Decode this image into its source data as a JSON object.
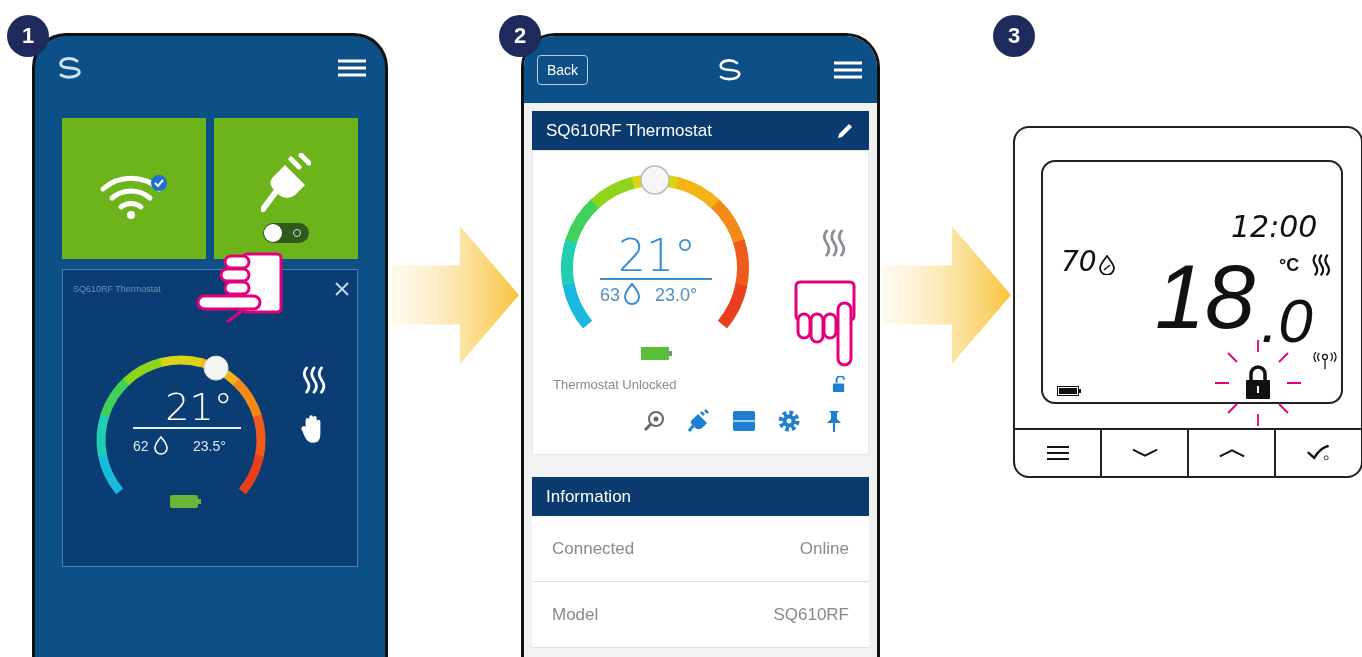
{
  "steps": [
    {
      "number": "1"
    },
    {
      "number": "2"
    },
    {
      "number": "3"
    }
  ],
  "phone_1": {
    "tiles": [
      {
        "kind": "wifi"
      },
      {
        "kind": "plug",
        "on": false
      }
    ],
    "thermostat_card": {
      "title": "SQ610RF Thermostat",
      "setpoint": "21°",
      "humidity": "62",
      "temperature": "23.5°",
      "level": 0.6
    }
  },
  "phone_2": {
    "back_button": "Back",
    "card_title": "SQ610RF Thermostat",
    "setpoint": "21°",
    "humidity": "63",
    "temperature": "23.0°",
    "level": 0.5,
    "status": "Thermostat Unlocked",
    "locked": false,
    "information": {
      "title": "Information",
      "rows": [
        {
          "label": "Connected",
          "value": "Online"
        },
        {
          "label": "Model",
          "value": "SQ610RF"
        }
      ]
    }
  },
  "thermostat_device": {
    "humidity": "70",
    "time": "12:00",
    "temperature_whole": "18",
    "temperature_decimal": ".0",
    "unit": "°C",
    "locked": true
  }
}
